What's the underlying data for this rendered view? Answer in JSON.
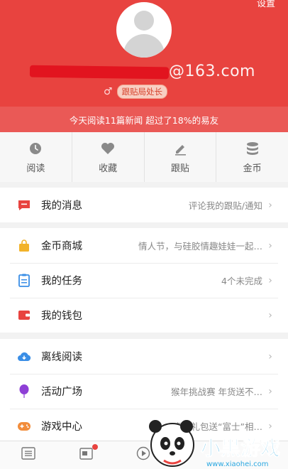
{
  "header": {
    "settings_label": "设置",
    "email_visible": "@163.com",
    "gender_symbol": "♂",
    "rank": "跟贴局处长",
    "reading_stat": "今天阅读11篇新闻 超过了18%的易友"
  },
  "quick_actions": [
    {
      "label": "阅读",
      "icon": "clock-icon"
    },
    {
      "label": "收藏",
      "icon": "heart-icon"
    },
    {
      "label": "跟贴",
      "icon": "pen-icon"
    },
    {
      "label": "金币",
      "icon": "coins-icon"
    }
  ],
  "menu": {
    "messages": {
      "label": "我的消息",
      "value": "评论我的跟贴/通知",
      "icon": "message-icon"
    },
    "mall": {
      "label": "金币商城",
      "value": "情人节，与硅胶情趣娃娃一起…",
      "icon": "bag-icon"
    },
    "tasks": {
      "label": "我的任务",
      "value": "4个未完成",
      "icon": "clipboard-icon"
    },
    "wallet": {
      "label": "我的钱包",
      "value": "",
      "icon": "wallet-icon"
    },
    "offline": {
      "label": "离线阅读",
      "value": "",
      "icon": "cloud-download-icon"
    },
    "events": {
      "label": "活动广场",
      "value": "猴年挑战赛 年货送不…",
      "icon": "balloon-icon"
    },
    "games": {
      "label": "游戏中心",
      "value": "春节礼包送“富士”相…",
      "icon": "gamepad-icon"
    }
  },
  "chevron": "›",
  "watermark": {
    "title": "小黑游戏",
    "url": "www.xiaohei.com"
  },
  "colors": {
    "brand_red": "#e8433f",
    "gold": "#f2b32a",
    "blue": "#3a8ee6",
    "purple": "#8e3fd6",
    "orange": "#f28c3a"
  }
}
